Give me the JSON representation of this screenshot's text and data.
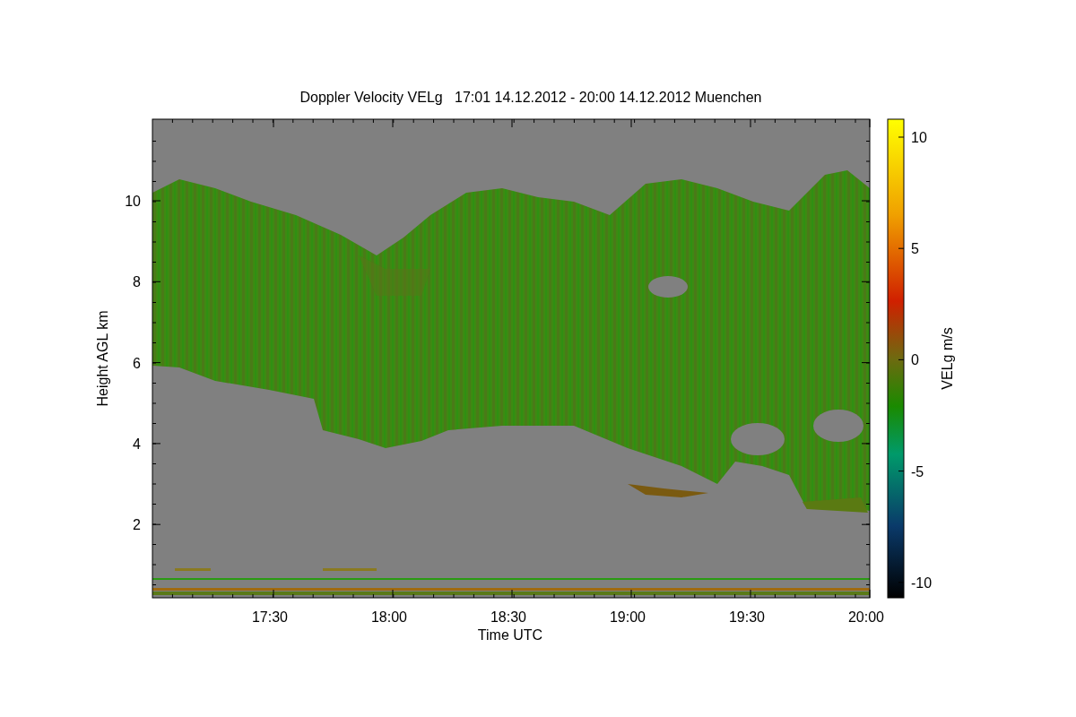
{
  "title": "Doppler Velocity VELg   17:01 14.12.2012 - 20:00 14.12.2012 Muenchen",
  "y_axis": {
    "label": "Height AGL km",
    "ticks": [
      "10",
      "8",
      "6",
      "4",
      "2"
    ]
  },
  "x_axis": {
    "label": "Time UTC",
    "ticks": [
      "17:30",
      "18:00",
      "18:30",
      "19:00",
      "19:30",
      "20:00"
    ]
  },
  "colorbar": {
    "label": "VELg m/s",
    "ticks": [
      "10",
      "5",
      "0",
      "-5",
      "-10"
    ]
  }
}
